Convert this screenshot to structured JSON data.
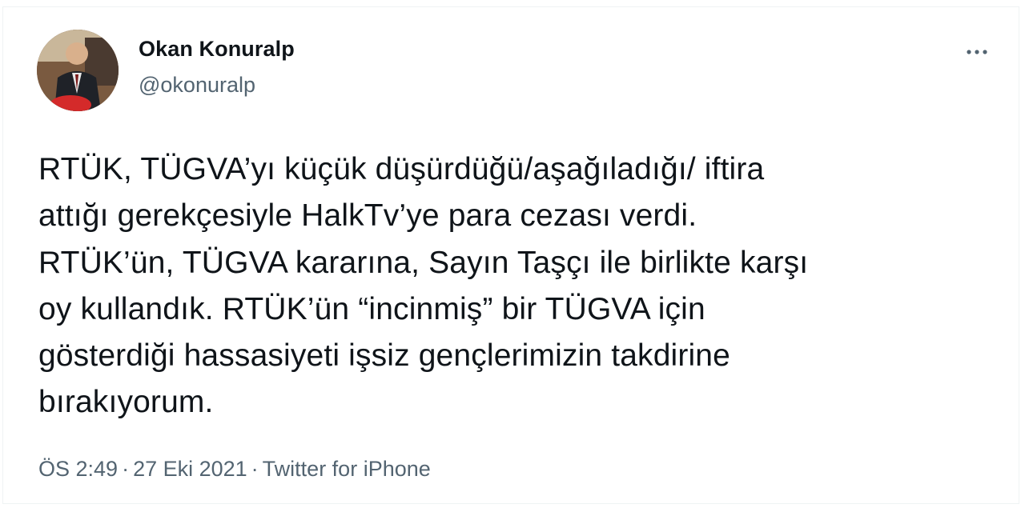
{
  "tweet": {
    "author": {
      "display_name": "Okan Konuralp",
      "handle": "@okonuralp",
      "avatar_icon": "profile-photo"
    },
    "more_icon": "more-horizontal-icon",
    "text": "RTÜK, TÜGVA’yı küçük düşürdüğü/aşağıladığı/ iftira\nattığı gerekçesiyle HalkTv’ye para cezası verdi.\nRTÜK’ün, TÜGVA kararına, Sayın Taşçı ile birlikte karşı\noy kullandık. RTÜK’ün “incinmiş” bir TÜGVA için\ngösterdiği hassasiyeti işsiz gençlerimizin takdirine\nbırakıyorum.",
    "time": "ÖS 2:49",
    "date": "27 Eki 2021",
    "separator": "·",
    "source": "Twitter for iPhone"
  },
  "colors": {
    "text_primary": "#0f1419",
    "text_secondary": "#536471",
    "border": "#eff3f4"
  }
}
